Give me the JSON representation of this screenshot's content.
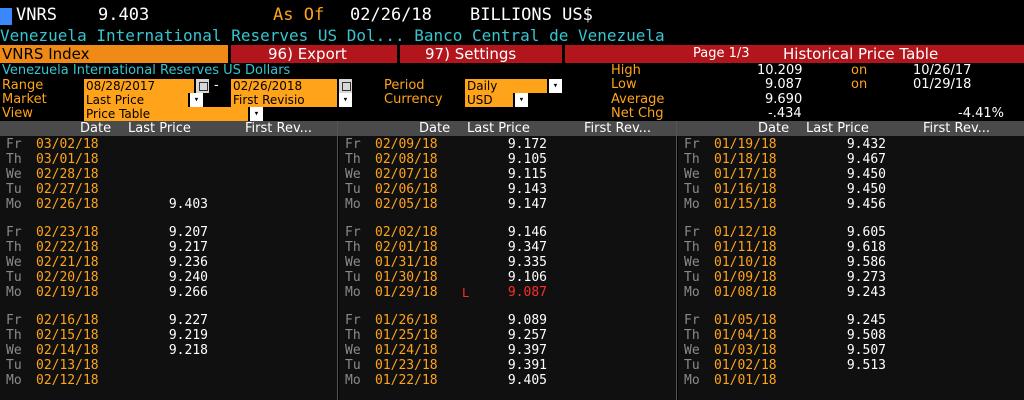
{
  "header": {
    "ticker": "VNRS",
    "value": "9.403",
    "asof_label": "As Of",
    "asof_date": "02/26/18",
    "units": "BILLIONS US$",
    "subtitle": "Venezuela International Reserves US Dol...  Banco Central de Venezuela"
  },
  "menu": {
    "index_label": "VNRS Index",
    "export_label": "96) Export",
    "settings_label": "97) Settings",
    "page_label": "Page 1/3",
    "title_label": "Historical Price Table"
  },
  "params": {
    "description": "Venezuela International Reserves US Dollars",
    "range_label": "Range",
    "range_start": "08/28/2017",
    "range_dash": "-",
    "range_end": "02/26/2018",
    "period_label": "Period",
    "period_value": "Daily",
    "market_label": "Market",
    "market_value": "Last Price",
    "market2_value": "First Revisio",
    "currency_label": "Currency",
    "currency_value": "USD",
    "view_label": "View",
    "view_value": "Price Table"
  },
  "stats": {
    "high_label": "High",
    "high_value": "10.209",
    "high_on": "on",
    "high_date": "10/26/17",
    "low_label": "Low",
    "low_value": "9.087",
    "low_on": "on",
    "low_date": "01/29/18",
    "avg_label": "Average",
    "avg_value": "9.690",
    "chg_label": "Net Chg",
    "chg_value": "-.434",
    "chg_pct": "-4.41%"
  },
  "table": {
    "col_date": "Date",
    "col_last": "Last Price",
    "col_first": "First Rev...",
    "columns": [
      {
        "rows": [
          {
            "day": "Fr",
            "date": "03/02/18",
            "last": ""
          },
          {
            "day": "Th",
            "date": "03/01/18",
            "last": ""
          },
          {
            "day": "We",
            "date": "02/28/18",
            "last": ""
          },
          {
            "day": "Tu",
            "date": "02/27/18",
            "last": ""
          },
          {
            "day": "Mo",
            "date": "02/26/18",
            "last": "9.403"
          },
          {
            "day": "Fr",
            "date": "02/23/18",
            "last": "9.207"
          },
          {
            "day": "Th",
            "date": "02/22/18",
            "last": "9.217"
          },
          {
            "day": "We",
            "date": "02/21/18",
            "last": "9.236"
          },
          {
            "day": "Tu",
            "date": "02/20/18",
            "last": "9.240"
          },
          {
            "day": "Mo",
            "date": "02/19/18",
            "last": "9.266"
          },
          {
            "day": "Fr",
            "date": "02/16/18",
            "last": "9.227"
          },
          {
            "day": "Th",
            "date": "02/15/18",
            "last": "9.219"
          },
          {
            "day": "We",
            "date": "02/14/18",
            "last": "9.218"
          },
          {
            "day": "Tu",
            "date": "02/13/18",
            "last": ""
          },
          {
            "day": "Mo",
            "date": "02/12/18",
            "last": ""
          }
        ]
      },
      {
        "rows": [
          {
            "day": "Fr",
            "date": "02/09/18",
            "last": "9.172"
          },
          {
            "day": "Th",
            "date": "02/08/18",
            "last": "9.105"
          },
          {
            "day": "We",
            "date": "02/07/18",
            "last": "9.115"
          },
          {
            "day": "Tu",
            "date": "02/06/18",
            "last": "9.143"
          },
          {
            "day": "Mo",
            "date": "02/05/18",
            "last": "9.147"
          },
          {
            "day": "Fr",
            "date": "02/02/18",
            "last": "9.146"
          },
          {
            "day": "Th",
            "date": "02/01/18",
            "last": "9.347"
          },
          {
            "day": "We",
            "date": "01/31/18",
            "last": "9.335"
          },
          {
            "day": "Tu",
            "date": "01/30/18",
            "last": "9.106"
          },
          {
            "day": "Mo",
            "date": "01/29/18",
            "last": "9.087",
            "low": true,
            "mark": "L"
          },
          {
            "day": "Fr",
            "date": "01/26/18",
            "last": "9.089"
          },
          {
            "day": "Th",
            "date": "01/25/18",
            "last": "9.257"
          },
          {
            "day": "We",
            "date": "01/24/18",
            "last": "9.397"
          },
          {
            "day": "Tu",
            "date": "01/23/18",
            "last": "9.391"
          },
          {
            "day": "Mo",
            "date": "01/22/18",
            "last": "9.405"
          }
        ]
      },
      {
        "rows": [
          {
            "day": "Fr",
            "date": "01/19/18",
            "last": "9.432"
          },
          {
            "day": "Th",
            "date": "01/18/18",
            "last": "9.467"
          },
          {
            "day": "We",
            "date": "01/17/18",
            "last": "9.450"
          },
          {
            "day": "Tu",
            "date": "01/16/18",
            "last": "9.450"
          },
          {
            "day": "Mo",
            "date": "01/15/18",
            "last": "9.456"
          },
          {
            "day": "Fr",
            "date": "01/12/18",
            "last": "9.605"
          },
          {
            "day": "Th",
            "date": "01/11/18",
            "last": "9.618"
          },
          {
            "day": "We",
            "date": "01/10/18",
            "last": "9.586"
          },
          {
            "day": "Tu",
            "date": "01/09/18",
            "last": "9.273"
          },
          {
            "day": "Mo",
            "date": "01/08/18",
            "last": "9.243"
          },
          {
            "day": "Fr",
            "date": "01/05/18",
            "last": "9.245"
          },
          {
            "day": "Th",
            "date": "01/04/18",
            "last": "9.508"
          },
          {
            "day": "We",
            "date": "01/03/18",
            "last": "9.507"
          },
          {
            "day": "Tu",
            "date": "01/02/18",
            "last": "9.513"
          },
          {
            "day": "Mo",
            "date": "01/01/18",
            "last": ""
          }
        ]
      }
    ]
  },
  "colors": {
    "amber": "#ffa31a",
    "cyan": "#36c5d1",
    "menu_red": "#b2161c",
    "low_red": "#ff2b2b"
  }
}
